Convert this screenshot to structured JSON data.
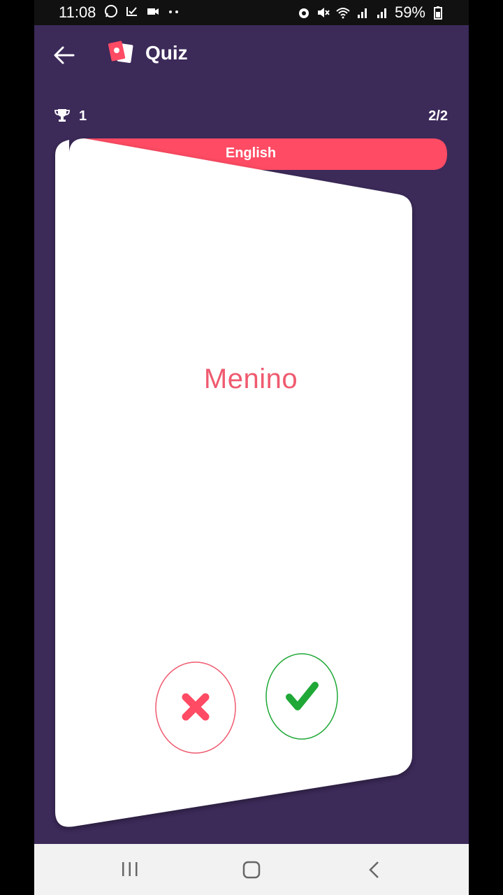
{
  "status_bar": {
    "time": "11:08",
    "battery": "59%",
    "left_icons": [
      "whatsapp-icon",
      "check-icon",
      "video-icon",
      "dots-icon"
    ],
    "right_icons": [
      "alarm-icon",
      "mute-icon",
      "wifi-icon",
      "signal-icon",
      "signal-icon",
      "battery-icon"
    ]
  },
  "app_bar": {
    "title": "Quiz",
    "back_icon": "arrow-left-icon",
    "logo_icon": "cards-logo-icon"
  },
  "quiz": {
    "score": "1",
    "progress": "2/2",
    "language": "English",
    "word": "Menino"
  },
  "colors": {
    "background": "#3c2a59",
    "accent": "#ff4b64",
    "wrong": "#ef5a6f",
    "correct": "#1fa836"
  }
}
